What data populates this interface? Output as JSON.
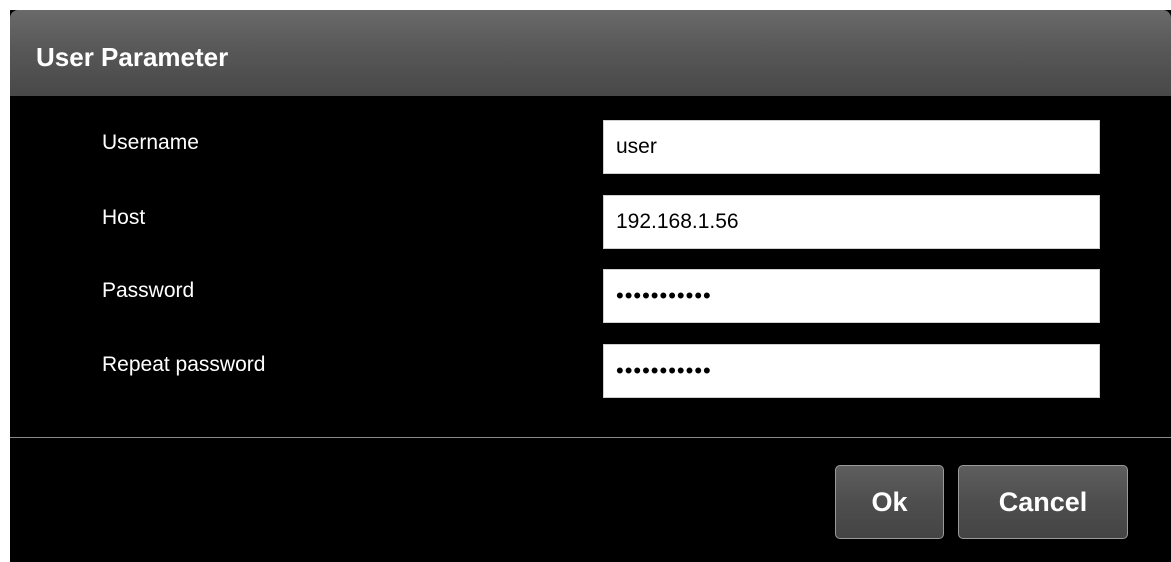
{
  "dialog": {
    "title": "User Parameter"
  },
  "fields": {
    "username": {
      "label": "Username",
      "value": "user"
    },
    "host": {
      "label": "Host",
      "value": "192.168.1.56"
    },
    "password": {
      "label": "Password",
      "value": "•••••••••••"
    },
    "repeat_password": {
      "label": "Repeat password",
      "value": "•••••••••••"
    }
  },
  "buttons": {
    "ok_label": "Ok",
    "cancel_label": "Cancel"
  },
  "colors": {
    "dialog_background": "#000000",
    "titlebar": "#585858",
    "input_background": "#ffffff",
    "button": "#505050"
  }
}
